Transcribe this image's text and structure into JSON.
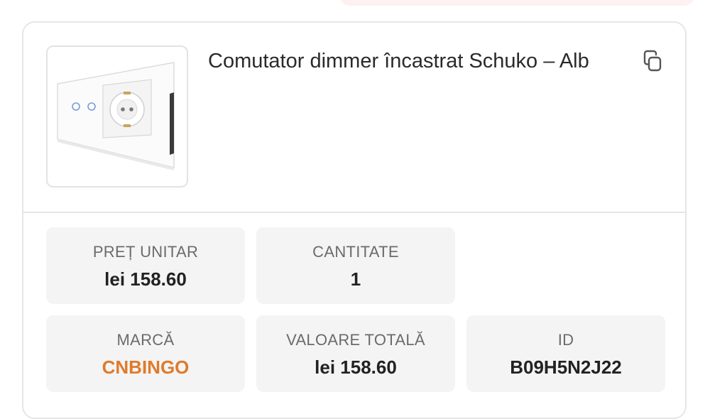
{
  "product": {
    "title": "Comutator dimmer încastrat Schuko – Alb",
    "image_icon": "wall-switch-socket-image"
  },
  "actions": {
    "copy_icon": "copy-icon"
  },
  "details": {
    "unit_price": {
      "label": "PREȚ UNITAR",
      "value": "lei 158.60"
    },
    "quantity": {
      "label": "CANTITATE",
      "value": "1"
    },
    "brand": {
      "label": "MARCĂ",
      "value": "CNBINGO"
    },
    "total_value": {
      "label": "VALOARE TOTALĂ",
      "value": "lei 158.60"
    },
    "id": {
      "label": "ID",
      "value": "B09H5N2J22"
    }
  },
  "colors": {
    "brand_accent": "#e07a2c",
    "tile_background": "#f4f4f4",
    "border": "#e6e6e6"
  }
}
